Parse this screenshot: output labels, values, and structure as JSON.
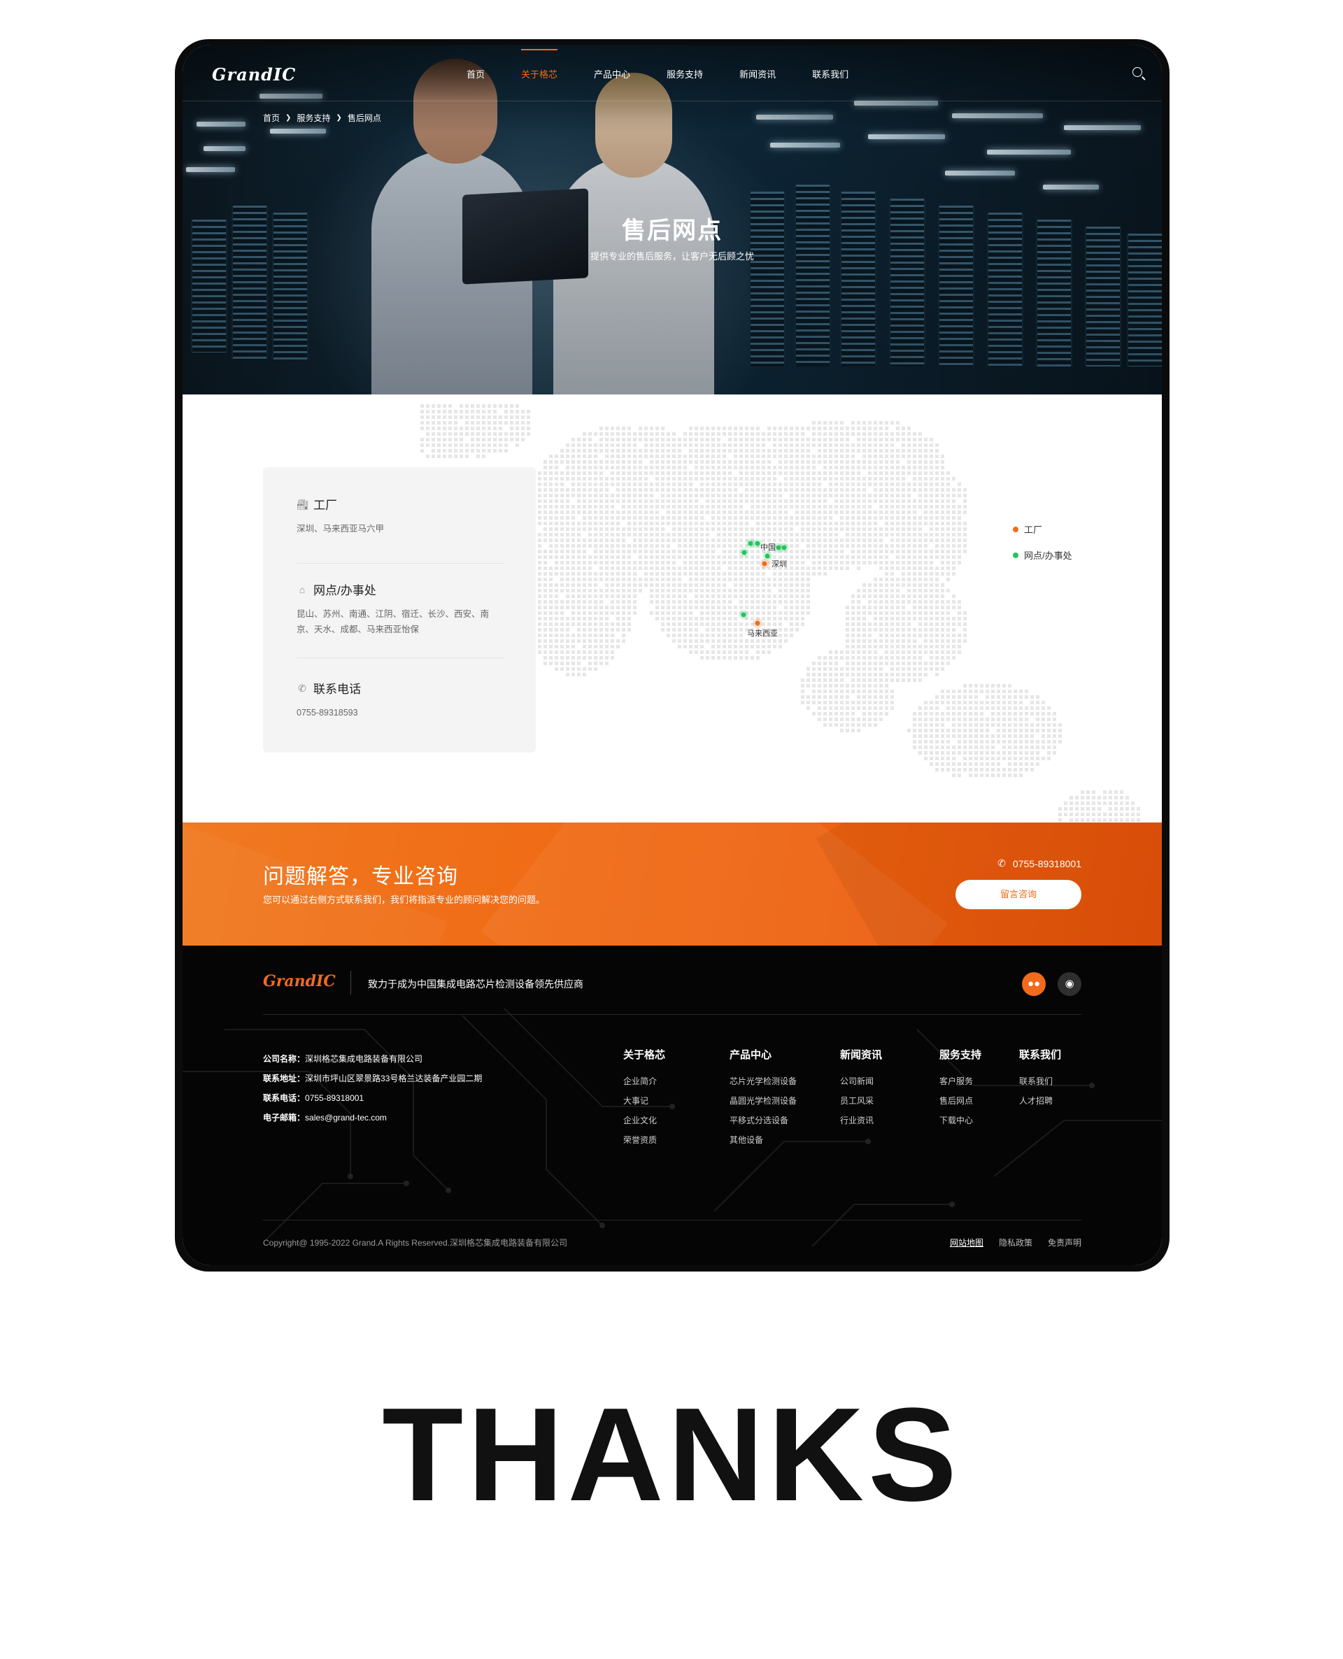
{
  "nav": {
    "logo": "GrandIC",
    "items": [
      "首页",
      "关于格芯",
      "产品中心",
      "服务支持",
      "新闻资讯",
      "联系我们"
    ],
    "active_index": 1
  },
  "breadcrumb": [
    "首页",
    "服务支持",
    "售后网点"
  ],
  "hero": {
    "title": "售后网点",
    "subtitle": "提供专业的售后服务，让客户无后顾之忧"
  },
  "info": {
    "factory_title": "工厂",
    "factory_text": "深圳、马来西亚马六甲",
    "office_title": "网点/办事处",
    "office_text": "昆山、苏州、南通、江阴、宿迁、长沙、西安、南京、天水、成都、马来西亚怡保",
    "phone_title": "联系电话",
    "phone_text": "0755-89318593"
  },
  "map": {
    "labels": {
      "china": "中国",
      "shenzhen": "深圳",
      "malaysia": "马来西亚"
    },
    "legend_factory": "工厂",
    "legend_office": "网点/办事处",
    "factory_color": "#f26a1b",
    "office_color": "#22c55e"
  },
  "cta": {
    "title": "问题解答，专业咨询",
    "subtitle": "您可以通过右侧方式联系我们，我们将指派专业的顾问解决您的问题。",
    "phone": "0755-89318001",
    "button": "留言咨询"
  },
  "footer": {
    "logo": "GrandIC",
    "slogan": "致力于成为中国集成电路芯片检测设备领先供应商",
    "contact": {
      "company_label": "公司名称：",
      "company": "深圳格芯集成电路装备有限公司",
      "address_label": "联系地址：",
      "address": "深圳市坪山区翠景路33号格兰达装备产业园二期",
      "phone_label": "联系电话：",
      "phone": "0755-89318001",
      "email_label": "电子邮箱：",
      "email": "sales@grand-tec.com"
    },
    "columns": [
      {
        "title": "关于格芯",
        "links": [
          "企业简介",
          "大事记",
          "企业文化",
          "荣誉资质"
        ]
      },
      {
        "title": "产品中心",
        "links": [
          "芯片光学检测设备",
          "晶圆光学检测设备",
          "平移式分选设备",
          "其他设备"
        ]
      },
      {
        "title": "新闻资讯",
        "links": [
          "公司新闻",
          "员工风采",
          "行业资讯"
        ]
      },
      {
        "title": "服务支持",
        "links": [
          "客户服务",
          "售后网点",
          "下载中心"
        ]
      },
      {
        "title": "联系我们",
        "links": [
          "联系我们",
          "人才招聘"
        ]
      }
    ],
    "copyright": "Copyright@ 1995-2022 Grand.A Rights Reserved.深圳格芯集成电路装备有限公司",
    "bottom_links": [
      "网站地图",
      "隐私政策",
      "免责声明"
    ],
    "wechat_color": "#f26a1b"
  },
  "thanks": "THANKS"
}
